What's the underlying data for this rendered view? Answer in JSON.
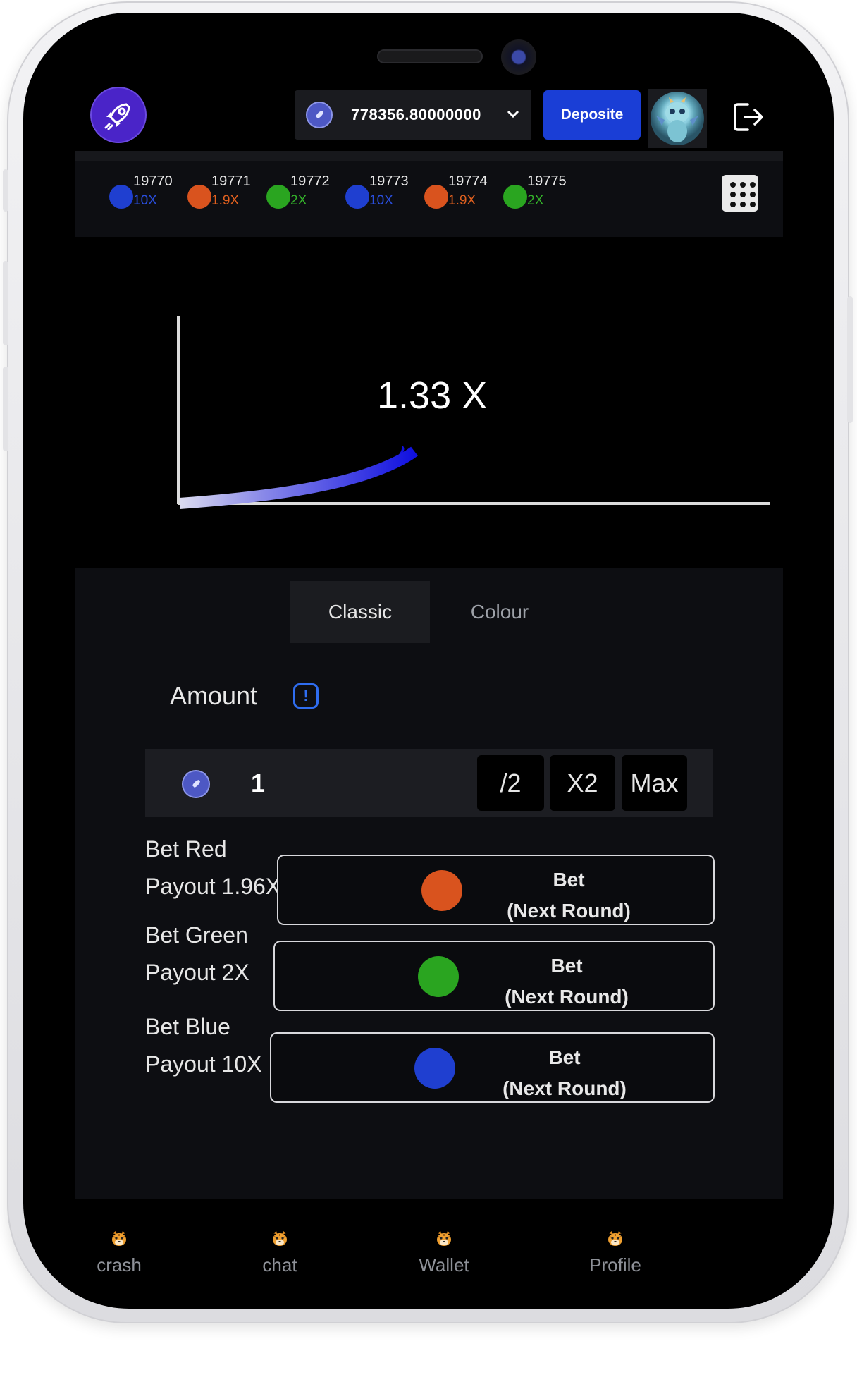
{
  "header": {
    "balance": "778356.80000000",
    "deposit_label": "Deposite"
  },
  "history": [
    {
      "round": "19770",
      "multiplier": "10X",
      "color": "#1f3fd0",
      "text_color": "#2a4fe0"
    },
    {
      "round": "19771",
      "multiplier": "1.9X",
      "color": "#d9531e",
      "text_color": "#e0601f"
    },
    {
      "round": "19772",
      "multiplier": "2X",
      "color": "#2aa520",
      "text_color": "#33b02a"
    },
    {
      "round": "19773",
      "multiplier": "10X",
      "color": "#1f3fd0",
      "text_color": "#2a4fe0"
    },
    {
      "round": "19774",
      "multiplier": "1.9X",
      "color": "#d9531e",
      "text_color": "#e0601f"
    },
    {
      "round": "19775",
      "multiplier": "2X",
      "color": "#2aa520",
      "text_color": "#33b02a"
    }
  ],
  "game": {
    "multiplier": "1.33 X"
  },
  "tabs": {
    "classic": "Classic",
    "colour": "Colour"
  },
  "amount": {
    "label": "Amount",
    "value": "1",
    "half_label": "/2",
    "double_label": "X2",
    "max_label": "Max"
  },
  "bets": [
    {
      "title": "Bet Red",
      "payout": "Payout 1.96X",
      "button_line1": "Bet",
      "button_line2": "(Next Round)",
      "color": "#d9531e"
    },
    {
      "title": "Bet Green",
      "payout": "Payout 2X",
      "button_line1": "Bet",
      "button_line2": "(Next Round)",
      "color": "#2aa520"
    },
    {
      "title": "Bet Blue",
      "payout": "Payout 10X",
      "button_line1": "Bet",
      "button_line2": "(Next Round)",
      "color": "#1f3fd0"
    }
  ],
  "nav": [
    {
      "label": "crash",
      "icon": "tiger-icon"
    },
    {
      "label": "chat",
      "icon": "tiger-icon"
    },
    {
      "label": "Wallet",
      "icon": "tiger-icon"
    },
    {
      "label": "Profile",
      "icon": "tiger-icon"
    }
  ],
  "colors": {
    "accent": "#1a3ed6",
    "logo": "#4a24c8",
    "background": "#000000",
    "panel": "#0d0e12"
  }
}
